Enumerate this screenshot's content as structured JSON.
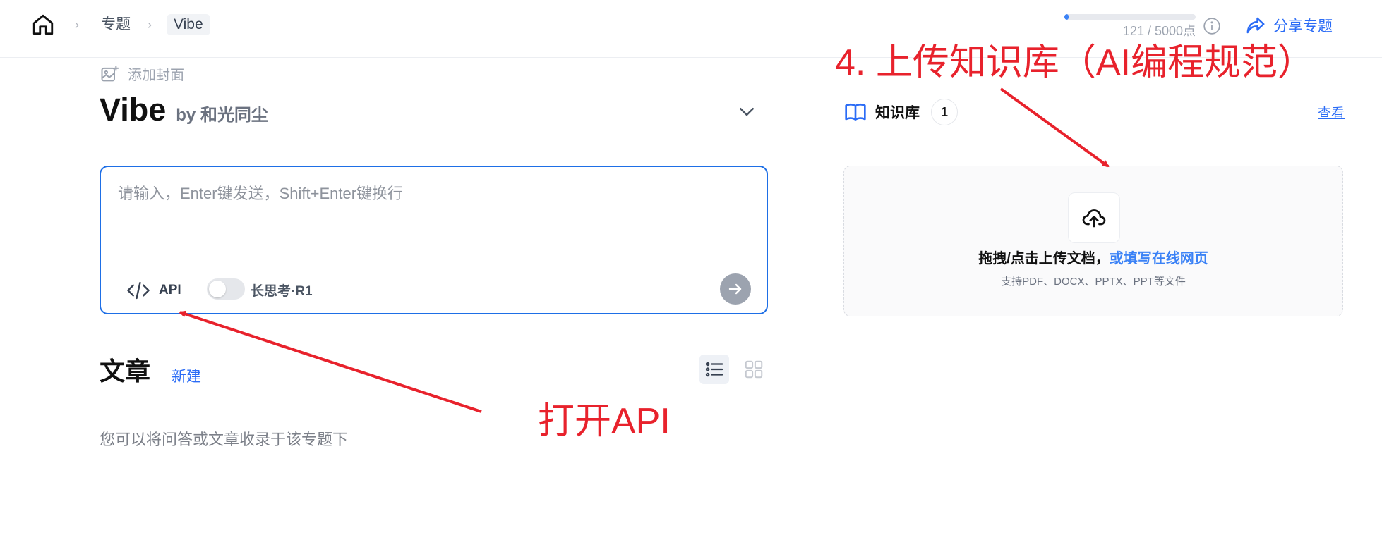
{
  "breadcrumb": {
    "items": [
      "专题",
      "Vibe"
    ]
  },
  "quota": {
    "text": "121 / 5000点",
    "used_fraction": 0.024,
    "bar_color": "#3b82f6"
  },
  "share": {
    "label": "分享专题"
  },
  "cover": {
    "label": "添加封面"
  },
  "topic": {
    "title": "Vibe",
    "author": "by 和光同尘"
  },
  "chat": {
    "placeholder": "请输入，Enter键发送，Shift+Enter键换行",
    "api_label": "API",
    "deep_think_label": "长思考·R1",
    "deep_think_on": false
  },
  "articles": {
    "heading": "文章",
    "new_label": "新建",
    "empty_text": "您可以将问答或文章收录于该专题下"
  },
  "knowledge_base": {
    "title": "知识库",
    "count": "1",
    "view_label": "查看",
    "upload_text": "拖拽/点击上传文档，",
    "upload_link": "或填写在线网页",
    "upload_hint": "支持PDF、DOCX、PPTX、PPT等文件"
  },
  "annotations": {
    "upload_note": "4. 上传知识库（AI编程规范）",
    "api_note": "打开API",
    "color": "#e8222c"
  },
  "colors": {
    "accent": "#2b6cf6",
    "input_border": "#1e6fe6"
  }
}
